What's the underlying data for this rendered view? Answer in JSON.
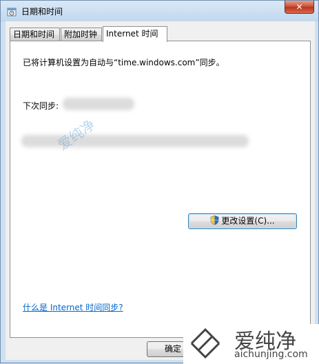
{
  "window": {
    "title": "日期和时间",
    "close_label": "✕"
  },
  "tabs": [
    {
      "label": "日期和时间",
      "active": false
    },
    {
      "label": "附加时钟",
      "active": false
    },
    {
      "label": "Internet 时间",
      "active": true
    }
  ],
  "panel": {
    "sync_text": "已将计算机设置为自动与“time.windows.com”同步。",
    "next_sync_label": "下次同步:",
    "change_settings_label": "更改设置(C)...",
    "help_link": "什么是 Internet 时间同步?"
  },
  "footer": {
    "ok_label": "确定"
  },
  "watermark": {
    "brand": "爱纯净",
    "url": "aichunjing.com"
  },
  "colors": {
    "link": "#0066cc",
    "close_button": "#c84a30",
    "watermark": "#3b8fd0"
  },
  "icons": [
    "clock-icon",
    "shield-icon",
    "close-icon"
  ]
}
